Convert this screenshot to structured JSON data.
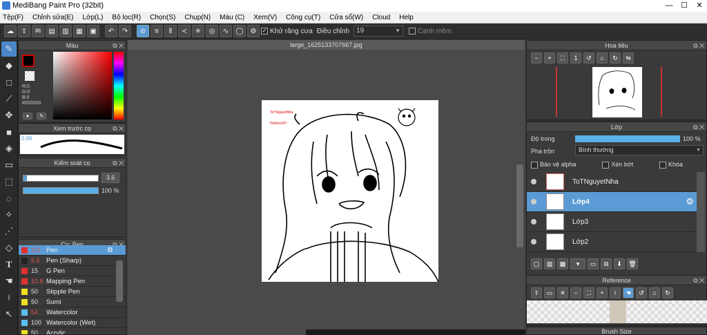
{
  "app": {
    "title": "MediBang Paint Pro (32bit)"
  },
  "menu": [
    "Tệp(F)",
    "Chỉnh sửa(E)",
    "Lớp(L)",
    "Bộ lọc(R)",
    "Chọn(S)",
    "Chụp(N)",
    "Màu (C)",
    "Xem(V)",
    "Công cụ(T)",
    "Cửa sổ(W)",
    "Cloud",
    "Help"
  ],
  "toolbar": {
    "antialias_label": "Khử răng cưa",
    "adjust_label": "Điều chỉnh",
    "adjust_value": "19",
    "smooth_label": "Canh mềm"
  },
  "panels": {
    "color": {
      "title": "Màu",
      "r": "R:0",
      "g": "G:0",
      "b": "B:0",
      "hex": "#000000",
      "primary": "#cc0000"
    },
    "brush_preview": {
      "title": "Xem trước cọ",
      "value": "0.96"
    },
    "brush_control": {
      "title": "Kiểm soát cọ",
      "size": "3.6",
      "opacity": "100 %"
    },
    "brush_list": {
      "title": "Cọ: Pen",
      "items": [
        {
          "size": "3.0",
          "name": "Pen",
          "color": "#e03030"
        },
        {
          "size": "5.6",
          "name": "Pen (Sharp)",
          "color": "#222222"
        },
        {
          "size": "15",
          "name": "G Pen",
          "color": "#e03030"
        },
        {
          "size": "10.8",
          "name": "Mapping Pen",
          "color": "#e03030"
        },
        {
          "size": "50",
          "name": "Stipple Pen",
          "color": "#f0e020"
        },
        {
          "size": "50",
          "name": "Sumi",
          "color": "#f0e020"
        },
        {
          "size": "54",
          "name": "Watercolor",
          "color": "#5bc0f0"
        },
        {
          "size": "100",
          "name": "Watercolor (Wet)",
          "color": "#5bc0f0"
        },
        {
          "size": "50",
          "name": "Acrylic",
          "color": "#f0e020"
        }
      ]
    },
    "navigator": {
      "title": "Hoa tiêu"
    },
    "layer": {
      "title": "Lớp",
      "opacity_label": "Độ trong",
      "opacity_value": "100 %",
      "blend_label": "Pha trộn",
      "blend_value": "Bình thường",
      "protect_alpha": "Bảo vệ alpha",
      "clipping": "Xén bớt",
      "lock": "Khóa",
      "layers": [
        {
          "name": "ToTNguyetNha",
          "selected": false
        },
        {
          "name": "Lớp4",
          "selected": true
        },
        {
          "name": "Lớp3",
          "selected": false
        },
        {
          "name": "Lớp2",
          "selected": false
        }
      ]
    },
    "reference": {
      "title": "Reference"
    },
    "brush_size": {
      "title": "Brush Size"
    }
  },
  "document": {
    "tab": "large_1625133707667.jpg",
    "watermark_line1": "ToTNguyetNha",
    "watermark_line2": "Hothon247"
  }
}
